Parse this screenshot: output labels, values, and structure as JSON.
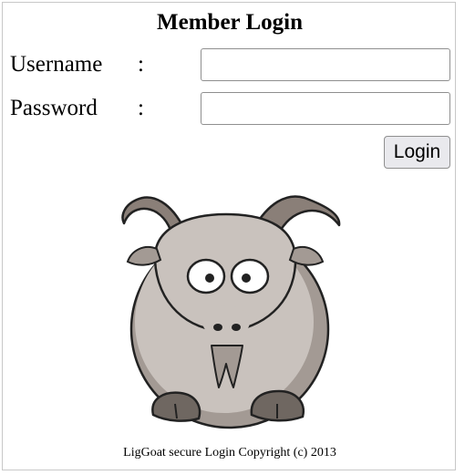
{
  "title": "Member Login",
  "form": {
    "username_label": "Username",
    "password_label": "Password",
    "separator": ":",
    "username_value": "",
    "password_value": "",
    "login_label": "Login"
  },
  "logo": {
    "icon": "goat-mascot-icon"
  },
  "footer": "LigGoat secure Login Copyright (c) 2013",
  "colors": {
    "goat_body": "#c9c2bd",
    "goat_shadow": "#a39a94",
    "horn": "#8a7f78",
    "outline": "#222222",
    "button_bg": "#e9e9ed"
  }
}
